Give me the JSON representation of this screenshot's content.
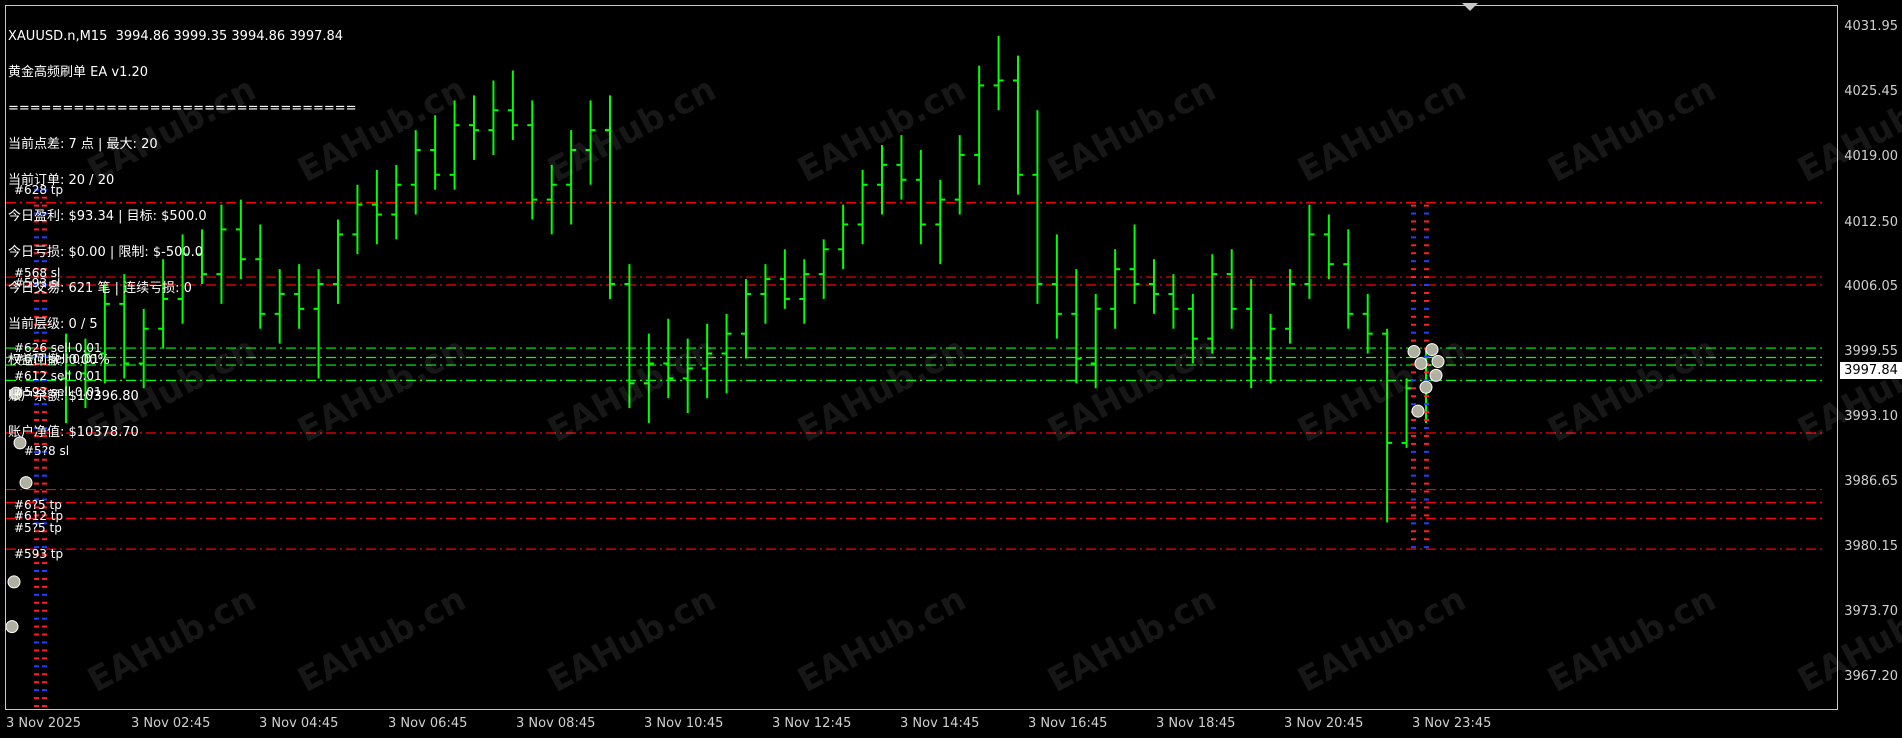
{
  "window": {
    "symbol_line": "XAUUSD.n,M15  3994.86 3999.35 3994.86 3997.84"
  },
  "info_panel": {
    "lines": [
      "黄金高频刷单 EA v1.20",
      "================================",
      "当前点差: 7 点 | 最大: 20",
      "当前订单: 20 / 20",
      "今日盈利: $93.34 | 目标: $500.0",
      "今日亏损: $0.00 | 限制: $-500.0",
      "今日交易: 621 笔 | 连续亏损: 0",
      "当前层级: 0 / 5",
      "权益回撤: 0.00%",
      "账户余额: $10396.80",
      "账户净值: $10378.70"
    ]
  },
  "price_axis": {
    "labels": [
      "4031.95",
      "4025.45",
      "4019.00",
      "4012.50",
      "4006.05",
      "3999.55",
      "3993.10",
      "3986.65",
      "3980.15",
      "3973.70",
      "3967.20"
    ],
    "current_price": "3997.84"
  },
  "time_axis": {
    "labels": [
      "3 Nov 2025",
      "3 Nov 02:45",
      "3 Nov 04:45",
      "3 Nov 06:45",
      "3 Nov 08:45",
      "3 Nov 10:45",
      "3 Nov 12:45",
      "3 Nov 14:45",
      "3 Nov 16:45",
      "3 Nov 18:45",
      "3 Nov 20:45",
      "3 Nov 23:45"
    ]
  },
  "order_labels": [
    "#628 tp",
    "#568 sl",
    "#593 sl",
    "#626 sell 0.01",
    "#6?? sell 0.01",
    "#612 sell 0.01",
    "#593 sell 0.01",
    "#5?8 sl",
    "#6?5 tp",
    "#612 tp",
    "#5?5 tp",
    "#593 tp"
  ],
  "watermark": "EAHub.cn",
  "colors": {
    "background": "#000000",
    "candle": "#00ff00",
    "sl_line": "#ff0000",
    "order_line": "#00ff00",
    "grid_text": "#d0d0d0"
  },
  "chart_data": {
    "type": "ohlc",
    "symbol": "XAUUSD.n",
    "timeframe": "M15",
    "ylim": [
      3963.0,
      4034.0
    ],
    "y_ticks": [
      4031.95,
      4025.45,
      4019.0,
      4012.5,
      4006.05,
      3999.55,
      3993.1,
      3986.65,
      3980.15,
      3973.7,
      3967.2
    ],
    "x_ticks": [
      "3 Nov 2025",
      "3 Nov 02:45",
      "3 Nov 04:45",
      "3 Nov 06:45",
      "3 Nov 08:45",
      "3 Nov 10:45",
      "3 Nov 12:45",
      "3 Nov 14:45",
      "3 Nov 16:45",
      "3 Nov 18:45",
      "3 Nov 20:45",
      "3 Nov 23:45"
    ],
    "last": {
      "open": 3994.86,
      "high": 3999.35,
      "low": 3994.86,
      "close": 3997.84
    },
    "bars": [
      [
        3996.5,
        4001.0,
        3992.0,
        3997.0
      ],
      [
        3997.0,
        4000.5,
        3993.5,
        3999.0
      ],
      [
        3999.0,
        4006.0,
        3996.0,
        4004.0
      ],
      [
        4004.0,
        4007.0,
        3996.5,
        3998.0
      ],
      [
        3998.0,
        4003.5,
        3995.5,
        4001.5
      ],
      [
        4001.5,
        4008.5,
        3999.5,
        4004.5
      ],
      [
        4004.5,
        4011.0,
        4002.0,
        4009.0
      ],
      [
        4009.0,
        4011.5,
        4006.0,
        4007.0
      ],
      [
        4007.0,
        4014.0,
        4004.0,
        4011.5
      ],
      [
        4011.5,
        4014.5,
        4006.5,
        4008.5
      ],
      [
        4008.5,
        4012.0,
        4001.5,
        4003.0
      ],
      [
        4003.0,
        4007.5,
        4000.0,
        4005.0
      ],
      [
        4005.0,
        4008.0,
        4001.5,
        4003.5
      ],
      [
        4003.5,
        4007.5,
        3996.5,
        4006.0
      ],
      [
        4006.0,
        4012.5,
        4004.0,
        4011.0
      ],
      [
        4011.0,
        4016.0,
        4009.0,
        4014.0
      ],
      [
        4014.0,
        4017.5,
        4010.0,
        4013.0
      ],
      [
        4013.0,
        4018.0,
        4010.5,
        4016.0
      ],
      [
        4016.0,
        4021.5,
        4013.0,
        4019.5
      ],
      [
        4019.5,
        4023.0,
        4015.5,
        4017.0
      ],
      [
        4017.0,
        4024.5,
        4015.5,
        4022.0
      ],
      [
        4022.0,
        4025.0,
        4018.5,
        4021.5
      ],
      [
        4021.5,
        4026.5,
        4019.0,
        4023.5
      ],
      [
        4023.5,
        4027.5,
        4020.5,
        4022.0
      ],
      [
        4022.0,
        4024.5,
        4012.5,
        4014.5
      ],
      [
        4014.5,
        4018.0,
        4011.0,
        4016.0
      ],
      [
        4016.0,
        4021.5,
        4012.0,
        4019.5
      ],
      [
        4019.5,
        4024.5,
        4016.0,
        4021.5
      ],
      [
        4021.5,
        4025.0,
        4004.5,
        4006.0
      ],
      [
        4006.0,
        4008.0,
        3993.5,
        3996.0
      ],
      [
        3996.0,
        4001.0,
        3992.0,
        3998.0
      ],
      [
        3998.0,
        4002.5,
        3994.5,
        3996.5
      ],
      [
        3996.5,
        4000.5,
        3993.0,
        3997.5
      ],
      [
        3997.5,
        4002.0,
        3994.5,
        3999.0
      ],
      [
        3999.0,
        4003.0,
        3995.0,
        4001.0
      ],
      [
        4001.0,
        4006.5,
        3998.5,
        4005.0
      ],
      [
        4005.0,
        4008.0,
        4002.0,
        4006.5
      ],
      [
        4006.5,
        4009.5,
        4003.5,
        4004.5
      ],
      [
        4004.5,
        4008.5,
        4002.0,
        4007.0
      ],
      [
        4007.0,
        4010.5,
        4004.5,
        4009.5
      ],
      [
        4009.5,
        4014.0,
        4007.5,
        4012.0
      ],
      [
        4012.0,
        4017.5,
        4010.0,
        4016.0
      ],
      [
        4016.0,
        4020.0,
        4013.0,
        4018.0
      ],
      [
        4018.0,
        4021.0,
        4014.5,
        4016.5
      ],
      [
        4016.5,
        4019.5,
        4010.0,
        4012.0
      ],
      [
        4012.0,
        4016.5,
        4008.0,
        4014.5
      ],
      [
        4014.5,
        4021.0,
        4013.0,
        4019.0
      ],
      [
        4019.0,
        4028.0,
        4016.0,
        4026.0
      ],
      [
        4026.0,
        4031.0,
        4023.5,
        4026.5
      ],
      [
        4026.5,
        4029.0,
        4015.0,
        4017.0
      ],
      [
        4017.0,
        4023.5,
        4004.0,
        4006.0
      ],
      [
        4006.0,
        4011.0,
        4000.5,
        4003.0
      ],
      [
        4003.0,
        4007.5,
        3996.0,
        3998.5
      ],
      [
        3998.0,
        4005.0,
        3995.5,
        4003.5
      ],
      [
        4003.5,
        4009.5,
        4001.5,
        4007.5
      ],
      [
        4007.5,
        4012.0,
        4004.0,
        4006.0
      ],
      [
        4006.0,
        4008.5,
        4003.0,
        4005.0
      ],
      [
        4005.0,
        4007.0,
        4001.5,
        4003.5
      ],
      [
        4003.5,
        4005.0,
        3998.0,
        4000.5
      ],
      [
        4000.5,
        4009.0,
        3999.0,
        4007.0
      ],
      [
        4007.0,
        4009.5,
        4001.5,
        4003.5
      ],
      [
        4003.5,
        4006.5,
        3995.5,
        3998.5
      ],
      [
        3998.5,
        4003.0,
        3996.0,
        4001.5
      ],
      [
        4001.5,
        4007.5,
        4000.0,
        4006.0
      ],
      [
        4006.0,
        4014.0,
        4004.5,
        4011.0
      ],
      [
        4011.0,
        4013.0,
        4006.5,
        4008.0
      ],
      [
        4008.0,
        4011.5,
        4001.5,
        4003.0
      ],
      [
        4003.0,
        4005.0,
        3999.0,
        4001.0
      ],
      [
        4001.0,
        4001.5,
        3982.0,
        3990.0
      ],
      [
        3990.0,
        3996.5,
        3989.5,
        3995.5
      ],
      [
        3995.5,
        3999.5,
        3992.0,
        3997.84
      ]
    ]
  }
}
